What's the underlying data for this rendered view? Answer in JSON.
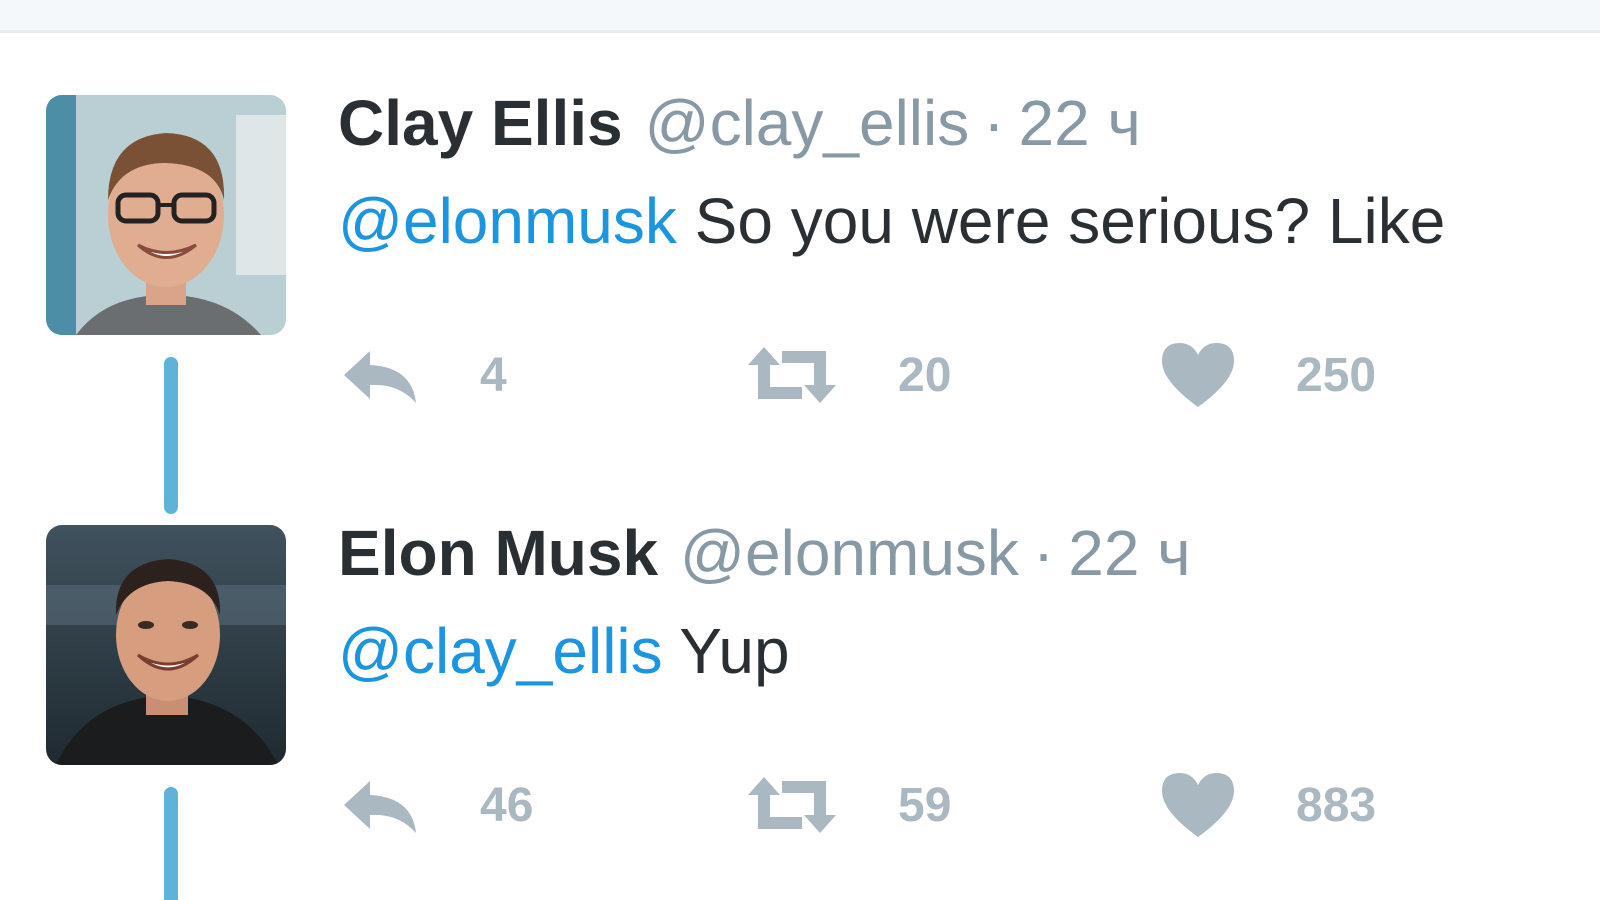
{
  "tweets": [
    {
      "name": "Clay Ellis",
      "handle": "@clay_ellis",
      "separator": "·",
      "time": "22 ч",
      "mention": "@elonmusk",
      "text": " So you were serious? Like",
      "actions": {
        "replies": "4",
        "retweets": "20",
        "likes": "250"
      }
    },
    {
      "name": "Elon Musk",
      "handle": "@elonmusk",
      "separator": "·",
      "time": "22 ч",
      "mention": "@clay_ellis",
      "text": " Yup",
      "actions": {
        "replies": "46",
        "retweets": "59",
        "likes": "883"
      }
    }
  ],
  "icons": {
    "reply": "reply-icon",
    "retweet": "retweet-icon",
    "like": "heart-icon"
  },
  "colors": {
    "mention": "#1b95e0",
    "thread_line": "#5fb3d9",
    "muted": "#8899a6",
    "action": "#aab8c2"
  }
}
